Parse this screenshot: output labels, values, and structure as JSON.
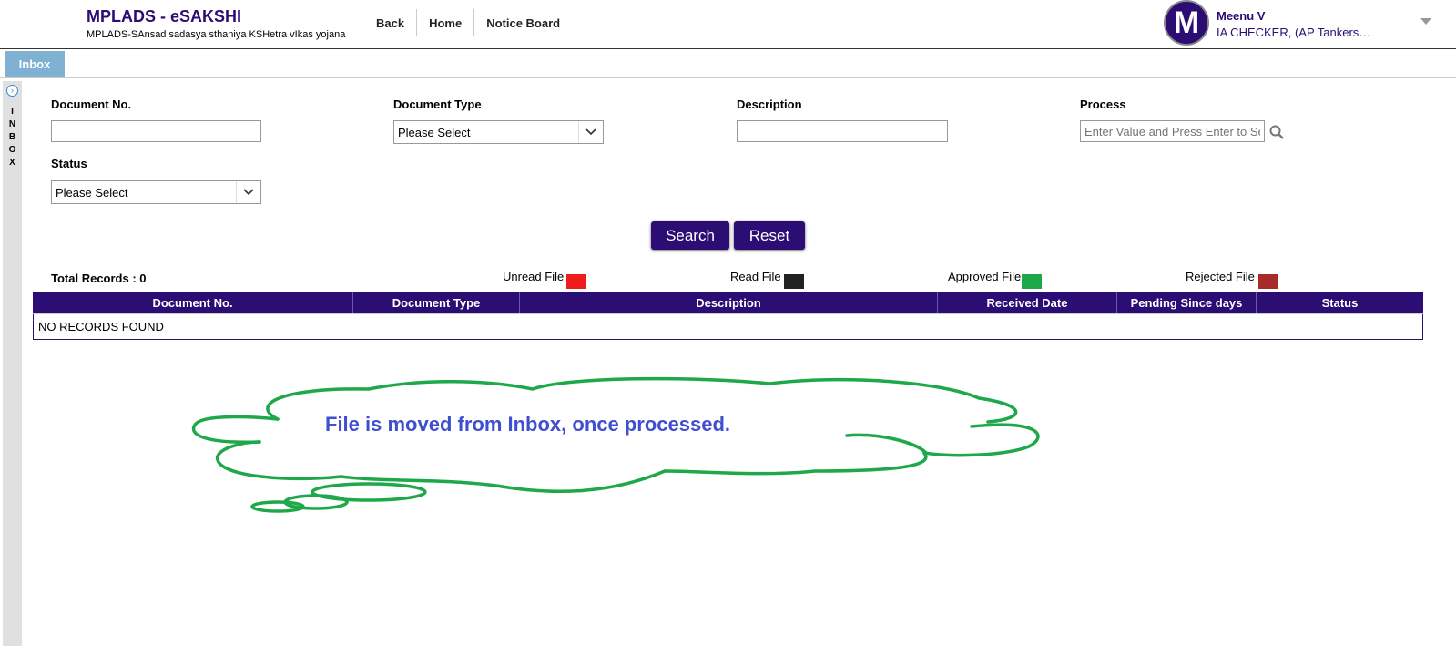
{
  "header": {
    "app_title": "MPLADS - eSAKSHI",
    "app_subtitle": "MPLADS-SAnsad sadasya sthaniya KSHetra vIkas yojana",
    "nav": [
      "Back",
      "Home",
      "Notice Board"
    ],
    "user": {
      "avatar_letter": "M",
      "name": "Meenu V",
      "role": "IA CHECKER, (AP Tankers…"
    }
  },
  "tabs": {
    "active": "Inbox"
  },
  "side_panel": {
    "label": "INBOX"
  },
  "filters": {
    "document_no": {
      "label": "Document No.",
      "value": ""
    },
    "document_type": {
      "label": "Document Type",
      "selected": "Please Select"
    },
    "description": {
      "label": "Description",
      "value": ""
    },
    "process": {
      "label": "Process",
      "placeholder": "Enter Value and Press Enter to Search"
    },
    "status": {
      "label": "Status",
      "selected": "Please Select"
    }
  },
  "actions": {
    "search": "Search",
    "reset": "Reset"
  },
  "records": {
    "total_label": "Total Records : 0"
  },
  "legend": [
    {
      "label": "Unread File",
      "color": "#ee1c1c"
    },
    {
      "label": "Read File",
      "color": "#222222"
    },
    {
      "label": "Approved File",
      "color": "#1fa84a"
    },
    {
      "label": "Rejected File",
      "color": "#a82a2a"
    }
  ],
  "table": {
    "columns": [
      "Document No.",
      "Document Type",
      "Description",
      "Received Date",
      "Pending Since days",
      "Status"
    ],
    "empty_message": "NO RECORDS FOUND"
  },
  "annotation": {
    "text": "File is moved from Inbox, once processed.",
    "outline_color": "#1fa84a",
    "text_color": "#3f4fd0"
  }
}
